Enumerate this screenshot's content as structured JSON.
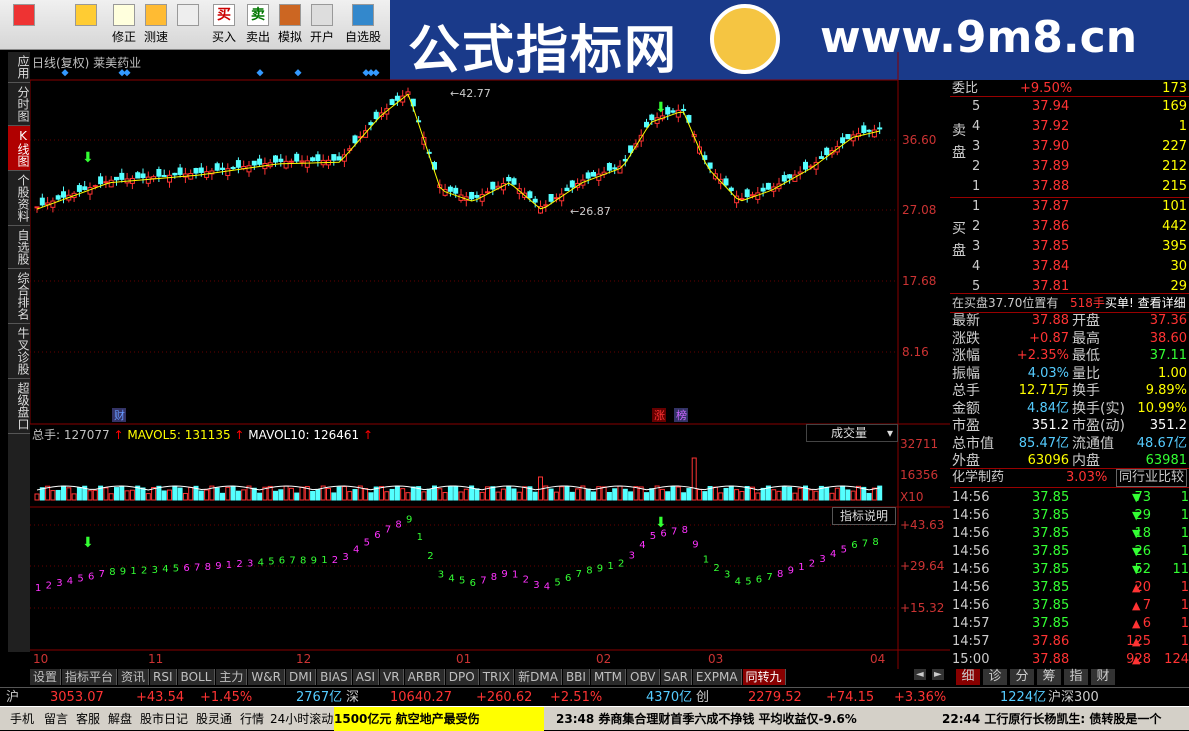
{
  "toolbar": {
    "buttons": [
      {
        "label": "",
        "icon": "grid-icon"
      },
      {
        "label": "",
        "icon": "back-arrow-icon"
      },
      {
        "label": "修正",
        "icon": "up-down-arrow-icon"
      },
      {
        "label": "测速",
        "icon": "speed-icon"
      },
      {
        "label": "",
        "icon": "clock-icon"
      },
      {
        "label": "买入",
        "icon": "buy-icon",
        "glyph": "买"
      },
      {
        "label": "卖出",
        "icon": "sell-icon",
        "glyph": "卖"
      },
      {
        "label": "模拟",
        "icon": "hammer-icon"
      },
      {
        "label": "开户",
        "icon": "lock-icon"
      },
      {
        "label": "自选股",
        "icon": "star-folder-icon"
      }
    ]
  },
  "banner": {
    "title": "公式指标网",
    "url": "www.9m8.cn"
  },
  "chart_title": "日线(复权)  莱美药业",
  "left_tabs": [
    {
      "label": "应用"
    },
    {
      "label": "分时图"
    },
    {
      "label": "K线图"
    },
    {
      "label": "个股资料"
    },
    {
      "label": "自选股"
    },
    {
      "label": "综合排名"
    },
    {
      "label": "牛叉诊股"
    },
    {
      "label": "超级盘口"
    }
  ],
  "price_axis": [
    "36.60",
    "27.08",
    "17.68",
    "8.16"
  ],
  "price_marks": {
    "high": "42.77",
    "low": "26.87"
  },
  "vol_axis": [
    "32711",
    "16356",
    "X10"
  ],
  "vol_legend": {
    "total": "总手: 127077",
    "mavol5": "MAVOL5: 131135",
    "mavol10": "MAVOL10: 126461"
  },
  "vol_dropdown": "成交量",
  "ind_button": "指标说明",
  "ind_axis": [
    "+43.63",
    "+29.64",
    "+15.32"
  ],
  "event_labels": {
    "cai": "财",
    "zhang": "涨",
    "bang": "榜"
  },
  "x_labels": [
    "10",
    "11",
    "12",
    "01",
    "02",
    "03",
    "04"
  ],
  "bottom_tabs": [
    "设置",
    "指标平台",
    "资讯",
    "RSI",
    "BOLL",
    "主力",
    "W&R",
    "DMI",
    "BIAS",
    "ASI",
    "VR",
    "ARBR",
    "DPO",
    "TRIX",
    "新DMA",
    "BBI",
    "MTM",
    "OBV",
    "SAR",
    "EXPMA",
    "同转九"
  ],
  "right_tabs": [
    "细",
    "诊",
    "分",
    "筹",
    "指",
    "财"
  ],
  "orderbook": {
    "header_label": "委比",
    "header_val": "+9.50%",
    "header_num": "173",
    "sell_label": "卖盘",
    "buy_label": "买盘",
    "sell": [
      {
        "lvl": "5",
        "price": "37.94",
        "vol": "169"
      },
      {
        "lvl": "4",
        "price": "37.92",
        "vol": "1"
      },
      {
        "lvl": "3",
        "price": "37.90",
        "vol": "227"
      },
      {
        "lvl": "2",
        "price": "37.89",
        "vol": "212"
      },
      {
        "lvl": "1",
        "price": "37.88",
        "vol": "215"
      }
    ],
    "buy": [
      {
        "lvl": "1",
        "price": "37.87",
        "vol": "101"
      },
      {
        "lvl": "2",
        "price": "37.86",
        "vol": "442"
      },
      {
        "lvl": "3",
        "price": "37.85",
        "vol": "395"
      },
      {
        "lvl": "4",
        "price": "37.84",
        "vol": "30"
      },
      {
        "lvl": "5",
        "price": "37.81",
        "vol": "29"
      }
    ],
    "notice": "在买盘37.70位置有",
    "notice_num": "518手",
    "notice_link": "买单! 查看详细"
  },
  "quote": [
    {
      "k1": "最新",
      "v1": "37.88",
      "k2": "开盘",
      "v2": "37.36"
    },
    {
      "k1": "涨跌",
      "v1": "+0.87",
      "k2": "最高",
      "v2": "38.60"
    },
    {
      "k1": "涨幅",
      "v1": "+2.35%",
      "k2": "最低",
      "v2": "37.11"
    },
    {
      "k1": "振幅",
      "v1": "4.03%",
      "k2": "量比",
      "v2": "1.00"
    },
    {
      "k1": "总手",
      "v1": "12.71万",
      "k2": "换手",
      "v2": "9.89%"
    },
    {
      "k1": "金额",
      "v1": "4.84亿",
      "k2": "换手(实)",
      "v2": "10.99%"
    },
    {
      "k1": "市盈",
      "v1": "351.2",
      "k2": "市盈(动)",
      "v2": "351.2"
    },
    {
      "k1": "总市值",
      "v1": "85.47亿",
      "k2": "流通值",
      "v2": "48.67亿"
    },
    {
      "k1": "外盘",
      "v1": "63096",
      "k2": "内盘",
      "v2": "63981"
    }
  ],
  "industry": {
    "name": "化学制药",
    "pct": "3.03%",
    "button": "同行业比较"
  },
  "ticks": [
    {
      "t": "14:56",
      "p": "37.85",
      "v": "73",
      "last": "1"
    },
    {
      "t": "14:56",
      "p": "37.85",
      "v": "29",
      "last": "1"
    },
    {
      "t": "14:56",
      "p": "37.85",
      "v": "18",
      "last": "1"
    },
    {
      "t": "14:56",
      "p": "37.85",
      "v": "26",
      "last": "1"
    },
    {
      "t": "14:56",
      "p": "37.85",
      "v": "52",
      "last": "11"
    },
    {
      "t": "14:56",
      "p": "37.85",
      "v": "20",
      "last": "1"
    },
    {
      "t": "14:56",
      "p": "37.85",
      "v": "7",
      "last": "1"
    },
    {
      "t": "14:57",
      "p": "37.85",
      "v": "6",
      "last": "1"
    },
    {
      "t": "14:57",
      "p": "37.86",
      "v": "125",
      "last": "1"
    },
    {
      "t": "15:00",
      "p": "37.88",
      "v": "928",
      "last": "124"
    }
  ],
  "index_bar": {
    "sh": "沪",
    "sh_val": "3053.07",
    "sh_chg": "+43.54",
    "sh_pct": "+1.45%",
    "sh_amt": "2767亿",
    "sz": "深",
    "sz_val": "10640.27",
    "sz_chg": "+260.62",
    "sz_pct": "+2.51%",
    "sz_amt": "4370亿",
    "cy": "创",
    "cy_val": "2279.52",
    "cy_chg": "+74.15",
    "cy_pct": "+3.36%",
    "cy_amt": "1224亿",
    "hs": "沪深300"
  },
  "status_bar": {
    "items": [
      "手机",
      "留言",
      "客服",
      "解盘",
      "股市日记",
      "股灵通",
      "行情",
      "24小时滚动"
    ],
    "news1": "1500亿元  航空地产最受伤",
    "news2": "23:48 券商集合理财首季六成不挣钱  平均收益仅-9.6%",
    "news3": "22:44 工行原行长杨凯生: 债转股是一个"
  }
}
